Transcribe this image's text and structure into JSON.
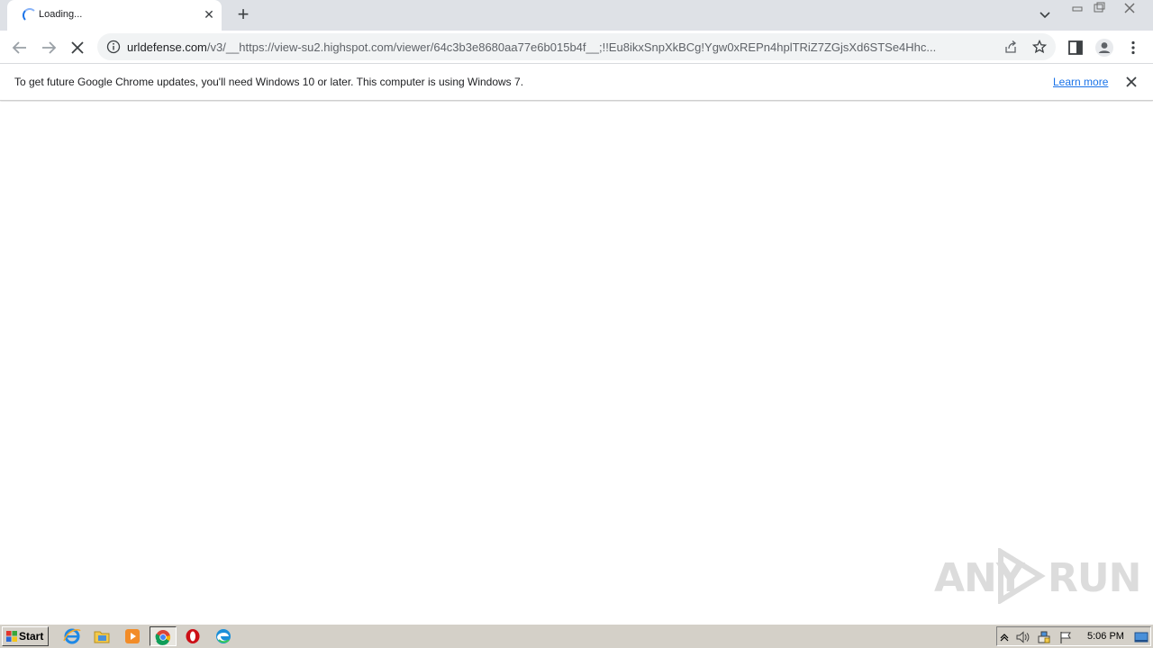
{
  "tab": {
    "title": "Loading...",
    "close_icon": "close-icon"
  },
  "toolbar": {
    "url_host": "urldefense.com",
    "url_rest": "/v3/__https://view-su2.highspot.com/viewer/64c3b3e8680aa77e6b015b4f__;!!Eu8ikxSnpXkBCg!Ygw0xREPn4hplTRiZ7ZGjsXd6STSe4Hhc...",
    "icons": [
      "back-icon",
      "forward-icon",
      "stop-icon",
      "info-icon",
      "share-icon",
      "star-icon",
      "side-panel-icon",
      "profile-icon",
      "menu-icon"
    ]
  },
  "infobar": {
    "message": "To get future Google Chrome updates, you'll need Windows 10 or later. This computer is using Windows 7.",
    "link": "Learn more"
  },
  "watermark": {
    "left": "ANY",
    "right": "RUN"
  },
  "taskbar": {
    "start_label": "Start",
    "apps": [
      "internet-explorer-icon",
      "folder-icon",
      "media-player-icon",
      "chrome-icon",
      "opera-icon",
      "edge-icon"
    ],
    "clock": "5:06 PM"
  },
  "colors": {
    "accent": "#1a73e8",
    "tabstrip": "#dee1e6",
    "taskbar": "#d4d0c8"
  }
}
